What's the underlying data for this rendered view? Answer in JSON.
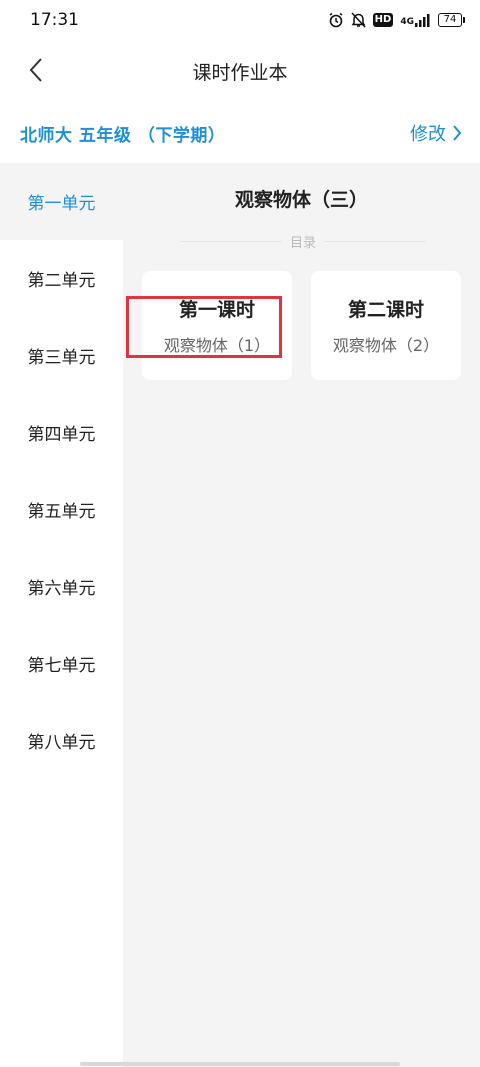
{
  "status_bar": {
    "time": "17:31",
    "icons": [
      "alarm-icon",
      "silent-bell-icon",
      "hd-icon",
      "signal-4g-icon",
      "battery-icon"
    ],
    "hd": "HD",
    "network": "4G",
    "battery": "74"
  },
  "nav": {
    "title": "课时作业本",
    "back_icon": "chevron-left-icon"
  },
  "book": {
    "info": "北师大 五年级 （下学期）",
    "edit_label": "修改",
    "edit_icon": "chevron-right-icon",
    "accent_color": "#1e8fd9"
  },
  "sidebar": {
    "items": [
      {
        "label": "第一单元",
        "active": true
      },
      {
        "label": "第二单元",
        "active": false
      },
      {
        "label": "第三单元",
        "active": false
      },
      {
        "label": "第四单元",
        "active": false
      },
      {
        "label": "第五单元",
        "active": false
      },
      {
        "label": "第六单元",
        "active": false
      },
      {
        "label": "第七单元",
        "active": false
      },
      {
        "label": "第八单元",
        "active": false
      }
    ]
  },
  "main": {
    "section_title": "观察物体（三）",
    "toc_label": "目录",
    "lessons": [
      {
        "name": "第一课时",
        "sub": "观察物体（1）",
        "highlighted": true
      },
      {
        "name": "第二课时",
        "sub": "观察物体（2）",
        "highlighted": false
      }
    ],
    "highlight_color": "#e03540"
  }
}
